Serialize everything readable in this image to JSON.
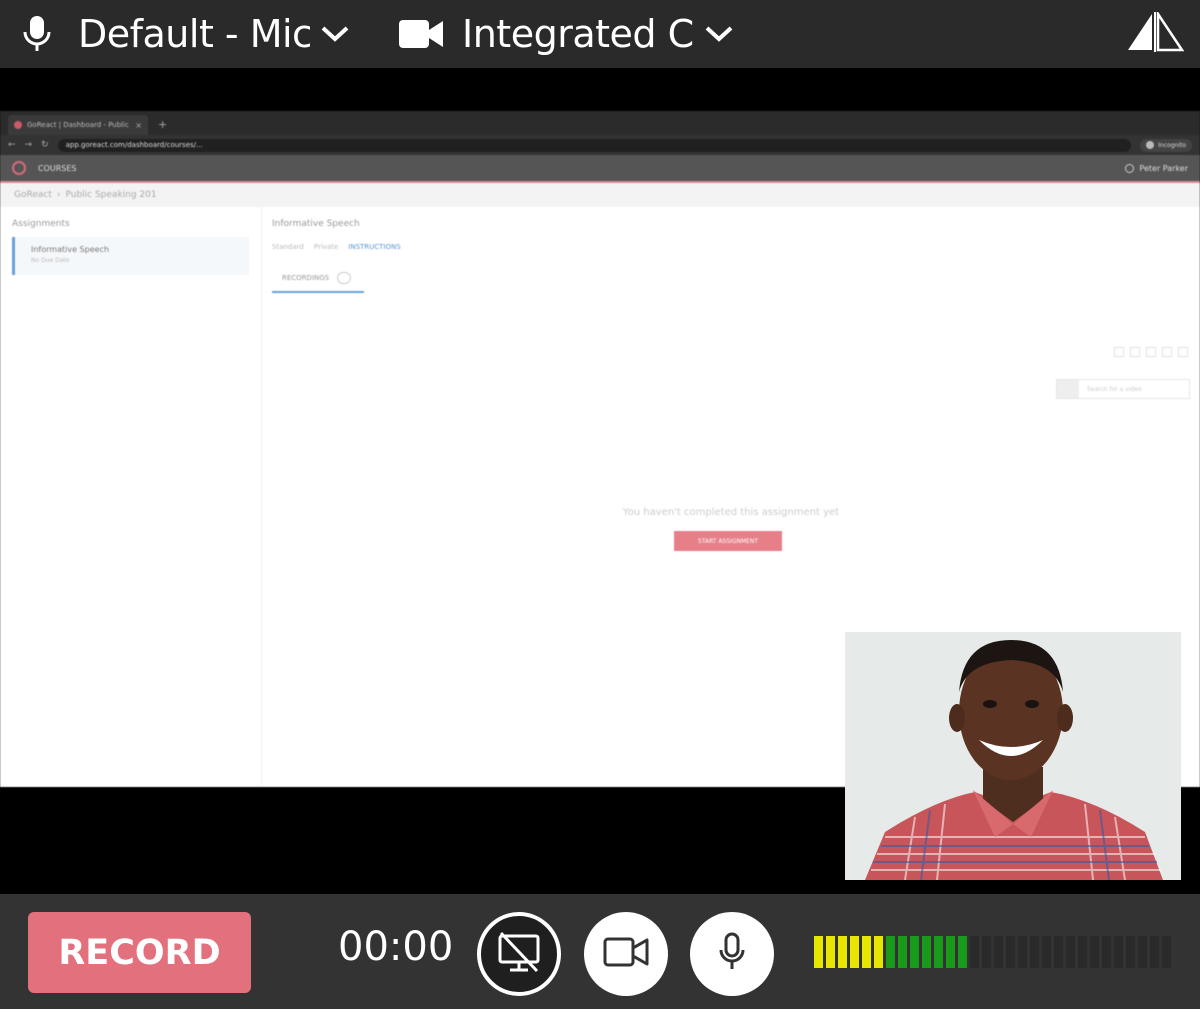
{
  "devices": {
    "microphone_label": "Default - Microphone",
    "camera_label": "Integrated Camera"
  },
  "screen_preview": {
    "browser_tab_title": "GoReact | Dashboard - Public Sp",
    "url": "app.goreact.com/dashboard/courses/...",
    "profile_label": "Incognito",
    "nav_menu": "COURSES",
    "user_menu": "Peter Parker",
    "breadcrumb": [
      "GoReact",
      "Public Speaking 201"
    ],
    "sidebar_heading": "Assignments",
    "assignment_title": "Informative Speech",
    "assignment_due": "No Due Date",
    "main_heading": "Informative Speech",
    "meta": [
      "Standard",
      "Private",
      "INSTRUCTIONS"
    ],
    "recordings_tab": "RECORDINGS",
    "search_placeholder": "Search for a video",
    "empty_message": "You haven't completed this assignment yet",
    "start_button": "START ASSIGNMENT"
  },
  "controls": {
    "record_label": "RECORD",
    "timer": "00:00",
    "audio_level_active_bars": 13,
    "audio_level_total_bars": 30
  },
  "colors": {
    "record": "#e2707d",
    "meter_yellow": "#e6e600",
    "meter_green": "#1a9a1a",
    "meter_off": "#2a2a2a"
  }
}
